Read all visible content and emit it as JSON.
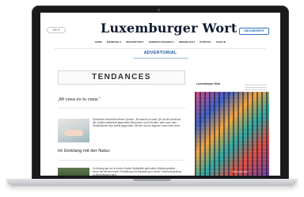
{
  "site": {
    "masthead": "Luxemburger Wort",
    "lang_selector": "DE ▾",
    "abo_button": "ABONNEMENT",
    "nav": [
      "HOME",
      "WERBUNG ▾",
      "INSCHRIFTEN ▾",
      "SONDERAUSGABEN ▾",
      "IMMOBILIEN ▾",
      "KONTAKT",
      "SAGE IN"
    ],
    "section_label": "ADVERTORIAL"
  },
  "main": {
    "category_banner": "TENDANCES",
    "articles": [
      {
        "title": "„Mi casa es tu casa.\"",
        "snippet": "Sprichwort beschreibt diesen Spruch: „Mi casa es tu casa\" (Es ist die Ausdruck der Gastfreundlichkeit gegenüber Besuchern und Fremden, aber auch dem Wohlbefinden sich selbst gegenüber. Mit ihm sich im eigenen Haus nicht wohl..."
      },
      {
        "title": "Im Einklang mit der Natur.",
        "snippet": "Im Anfang war der in einem Garten Spätkräfte gefundene Weltperspektive ... bevor der Mensch nach Gestaltung und Anpassung in seiner Lebensumgebung zu Bedürfnissen kam."
      }
    ]
  },
  "sidebar": {
    "heading": "Luxemburger Wort",
    "ad_caption": "Das gute Leben"
  }
}
